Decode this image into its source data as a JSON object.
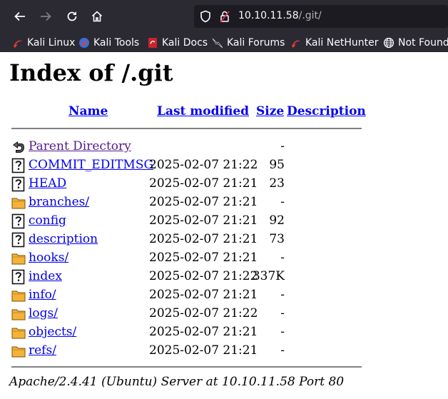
{
  "browser": {
    "url_host": "10.10.11.58",
    "url_path": "/.git/",
    "bookmarks": [
      {
        "label": "Kali Linux",
        "icon": "kali-dragon-icon"
      },
      {
        "label": "Kali Tools",
        "icon": "kali-tools-icon"
      },
      {
        "label": "Kali Docs",
        "icon": "kali-docs-icon"
      },
      {
        "label": "Kali Forums",
        "icon": "kali-forums-icon"
      },
      {
        "label": "Kali NetHunter",
        "icon": "kali-nethunter-icon"
      },
      {
        "label": "Not Found",
        "icon": "globe-icon"
      }
    ]
  },
  "page": {
    "title": "Index of /.git",
    "columns": {
      "name": "Name",
      "last_modified": "Last modified",
      "size": "Size",
      "description": "Description"
    },
    "rows": [
      {
        "name": "Parent Directory",
        "date": "",
        "size": "-",
        "icon": "back-icon",
        "visited": true
      },
      {
        "name": "COMMIT_EDITMSG",
        "date": "2025-02-07 21:22",
        "size": "95",
        "icon": "unknown-file-icon"
      },
      {
        "name": "HEAD",
        "date": "2025-02-07 21:21",
        "size": "23",
        "icon": "unknown-file-icon"
      },
      {
        "name": "branches/",
        "date": "2025-02-07 21:21",
        "size": "-",
        "icon": "folder-icon"
      },
      {
        "name": "config",
        "date": "2025-02-07 21:21",
        "size": "92",
        "icon": "unknown-file-icon"
      },
      {
        "name": "description",
        "date": "2025-02-07 21:21",
        "size": "73",
        "icon": "unknown-file-icon"
      },
      {
        "name": "hooks/",
        "date": "2025-02-07 21:21",
        "size": "-",
        "icon": "folder-icon"
      },
      {
        "name": "index",
        "date": "2025-02-07 21:22",
        "size": "337K",
        "icon": "unknown-file-icon"
      },
      {
        "name": "info/",
        "date": "2025-02-07 21:21",
        "size": "-",
        "icon": "folder-icon"
      },
      {
        "name": "logs/",
        "date": "2025-02-07 21:22",
        "size": "-",
        "icon": "folder-icon"
      },
      {
        "name": "objects/",
        "date": "2025-02-07 21:21",
        "size": "-",
        "icon": "folder-icon"
      },
      {
        "name": "refs/",
        "date": "2025-02-07 21:21",
        "size": "-",
        "icon": "folder-icon"
      }
    ],
    "footer": "Apache/2.4.41 (Ubuntu) Server at 10.10.11.58 Port 80"
  }
}
